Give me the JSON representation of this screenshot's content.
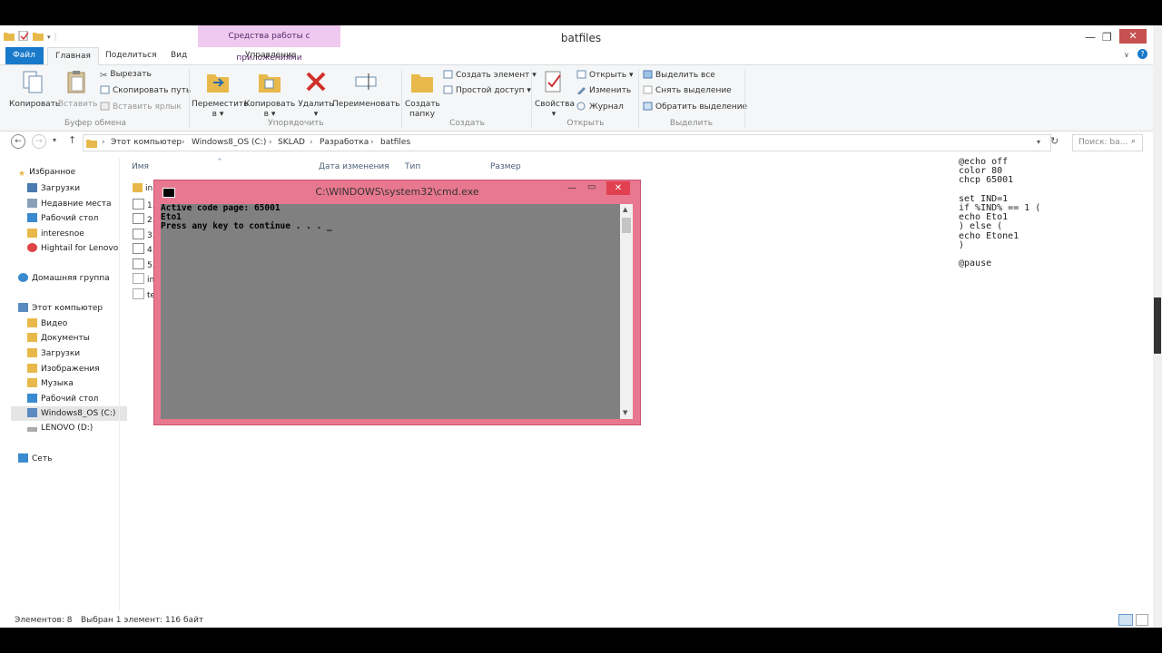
{
  "window": {
    "title": "batfiles",
    "context_tab": "Средства работы с приложениями",
    "min_icon": "minimize-icon",
    "max_icon": "maximize-icon",
    "close_icon": "close-icon"
  },
  "tabs": {
    "file": "Файл",
    "home": "Главная",
    "share": "Поделиться",
    "view": "Вид",
    "manage": "Управление"
  },
  "ribbon": {
    "copy": "Копировать",
    "paste": "Вставить",
    "cut": "Вырезать",
    "copy_path": "Скопировать путь",
    "paste_shortcut": "Вставить ярлык",
    "group_clipboard": "Буфер обмена",
    "move_to": "Переместить",
    "move_to_2": "в ▾",
    "copy_to": "Копировать",
    "copy_to_2": "в ▾",
    "delete": "Удалить",
    "delete_2": "▾",
    "rename": "Переименовать",
    "group_organize": "Упорядочить",
    "new_folder": "Создать",
    "new_folder_2": "папку",
    "new_item": "Создать элемент ▾",
    "easy_access": "Простой доступ ▾",
    "group_new": "Создать",
    "properties": "Свойства",
    "properties_2": "▾",
    "open": "Открыть ▾",
    "edit": "Изменить",
    "history": "Журнал",
    "group_open": "Открыть",
    "select_all": "Выделить все",
    "select_none": "Снять выделение",
    "invert_selection": "Обратить выделение",
    "group_select": "Выделить"
  },
  "address": {
    "crumbs": [
      "Этот компьютер",
      "Windows8_OS (C:)",
      "SKLAD",
      "Разработка",
      "batfiles"
    ],
    "search_placeholder": "Поиск: ba..."
  },
  "nav": {
    "favorites": "Избранное",
    "fav_items": [
      "Загрузки",
      "Недавние места",
      "Рабочий стол",
      "interesnoe",
      "Hightail for Lenovo"
    ],
    "homegroup": "Домашняя группа",
    "this_pc": "Этот компьютер",
    "pc_items": [
      "Видео",
      "Документы",
      "Загрузки",
      "Изображения",
      "Музыка",
      "Рабочий стол",
      "Windows8_OS (C:)",
      "LENOVO (D:)"
    ],
    "network": "Сеть"
  },
  "columns": {
    "name": "Имя",
    "date": "Дата изменения",
    "type": "Тип",
    "size": "Размер"
  },
  "files": [
    "in",
    "1.",
    "2.",
    "3.",
    "4.",
    "5.",
    "in",
    "te"
  ],
  "code_preview": "@echo off\ncolor 80\nchcp 65001\n\nset IND=1\nif %IND% == 1 (\necho Eto1\n) else (\necho Etone1\n)\n\n@pause",
  "cmd": {
    "title": "C:\\WINDOWS\\system32\\cmd.exe",
    "output": "Active code page: 65001\nEto1\nPress any key to continue . . . _"
  },
  "status": {
    "count": "Элементов: 8",
    "selected": "Выбран 1 элемент: 116 байт"
  },
  "colors": {
    "file_tab": "#1979ca",
    "cmd_frame": "#e8788f",
    "cmd_bg": "#808080",
    "close": "#c75050"
  }
}
